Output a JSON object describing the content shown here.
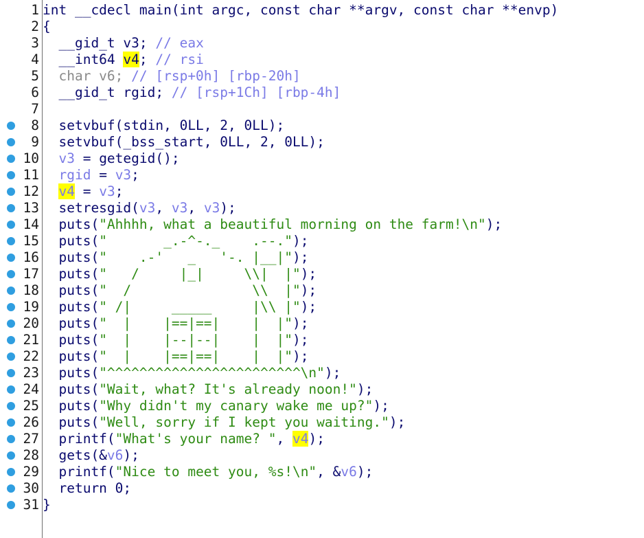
{
  "editor": {
    "lines": [
      {
        "no": "1",
        "bp": false,
        "parts": [
          {
            "c": "kw",
            "t": "int __cdecl main(int argc, const char **argv, const char **envp)"
          }
        ]
      },
      {
        "no": "2",
        "bp": false,
        "parts": [
          {
            "c": "kw",
            "t": "{"
          }
        ]
      },
      {
        "no": "3",
        "bp": false,
        "parts": [
          {
            "c": "kw",
            "t": "  __gid_t v3; "
          },
          {
            "c": "cm",
            "t": "// eax"
          }
        ]
      },
      {
        "no": "4",
        "bp": false,
        "parts": [
          {
            "c": "kw",
            "t": "  __int64 "
          },
          {
            "c": "kw hl",
            "t": "v4"
          },
          {
            "c": "kw",
            "t": "; "
          },
          {
            "c": "cm",
            "t": "// rsi"
          }
        ]
      },
      {
        "no": "5",
        "bp": false,
        "parts": [
          {
            "c": "gr",
            "t": "  char v6; "
          },
          {
            "c": "cm",
            "t": "// [rsp+0h] [rbp-20h]"
          }
        ]
      },
      {
        "no": "6",
        "bp": false,
        "parts": [
          {
            "c": "kw",
            "t": "  __gid_t rgid; "
          },
          {
            "c": "cm",
            "t": "// [rsp+1Ch] [rbp-4h]"
          }
        ]
      },
      {
        "no": "7",
        "bp": false,
        "parts": [
          {
            "c": "kw",
            "t": ""
          }
        ]
      },
      {
        "no": "8",
        "bp": true,
        "parts": [
          {
            "c": "kw",
            "t": "  setvbuf(stdin, 0LL, 2, 0LL);"
          }
        ]
      },
      {
        "no": "9",
        "bp": true,
        "parts": [
          {
            "c": "kw",
            "t": "  setvbuf(_bss_start, 0LL, 2, 0LL);"
          }
        ]
      },
      {
        "no": "10",
        "bp": true,
        "parts": [
          {
            "c": "kw",
            "t": "  "
          },
          {
            "c": "v",
            "t": "v3"
          },
          {
            "c": "kw",
            "t": " = getegid();"
          }
        ]
      },
      {
        "no": "11",
        "bp": true,
        "parts": [
          {
            "c": "kw",
            "t": "  "
          },
          {
            "c": "v",
            "t": "rgid"
          },
          {
            "c": "kw",
            "t": " = "
          },
          {
            "c": "v",
            "t": "v3"
          },
          {
            "c": "kw",
            "t": ";"
          }
        ]
      },
      {
        "no": "12",
        "bp": true,
        "parts": [
          {
            "c": "kw",
            "t": "  "
          },
          {
            "c": "v hl",
            "t": "v4"
          },
          {
            "c": "kw",
            "t": " = "
          },
          {
            "c": "v",
            "t": "v3"
          },
          {
            "c": "kw",
            "t": ";"
          }
        ]
      },
      {
        "no": "13",
        "bp": true,
        "parts": [
          {
            "c": "kw",
            "t": "  setresgid("
          },
          {
            "c": "v",
            "t": "v3"
          },
          {
            "c": "kw",
            "t": ", "
          },
          {
            "c": "v",
            "t": "v3"
          },
          {
            "c": "kw",
            "t": ", "
          },
          {
            "c": "v",
            "t": "v3"
          },
          {
            "c": "kw",
            "t": ");"
          }
        ]
      },
      {
        "no": "14",
        "bp": true,
        "parts": [
          {
            "c": "kw",
            "t": "  puts("
          },
          {
            "c": "st",
            "t": "\"Ahhhh, what a beautiful morning on the farm!\\n\""
          },
          {
            "c": "kw",
            "t": ");"
          }
        ]
      },
      {
        "no": "15",
        "bp": true,
        "parts": [
          {
            "c": "kw",
            "t": "  puts("
          },
          {
            "c": "st",
            "t": "\"       _.-^-._    .--.\""
          },
          {
            "c": "kw",
            "t": ");"
          }
        ]
      },
      {
        "no": "16",
        "bp": true,
        "parts": [
          {
            "c": "kw",
            "t": "  puts("
          },
          {
            "c": "st",
            "t": "\"    .-'   _   '-. |__|\""
          },
          {
            "c": "kw",
            "t": ");"
          }
        ]
      },
      {
        "no": "17",
        "bp": true,
        "parts": [
          {
            "c": "kw",
            "t": "  puts("
          },
          {
            "c": "st",
            "t": "\"   /     |_|     \\\\|  |\""
          },
          {
            "c": "kw",
            "t": ");"
          }
        ]
      },
      {
        "no": "18",
        "bp": true,
        "parts": [
          {
            "c": "kw",
            "t": "  puts("
          },
          {
            "c": "st",
            "t": "\"  /               \\\\  |\""
          },
          {
            "c": "kw",
            "t": ");"
          }
        ]
      },
      {
        "no": "19",
        "bp": true,
        "parts": [
          {
            "c": "kw",
            "t": "  puts("
          },
          {
            "c": "st",
            "t": "\" /|     _____     |\\\\ |\""
          },
          {
            "c": "kw",
            "t": ");"
          }
        ]
      },
      {
        "no": "20",
        "bp": true,
        "parts": [
          {
            "c": "kw",
            "t": "  puts("
          },
          {
            "c": "st",
            "t": "\"  |    |==|==|    |  |\""
          },
          {
            "c": "kw",
            "t": ");"
          }
        ]
      },
      {
        "no": "21",
        "bp": true,
        "parts": [
          {
            "c": "kw",
            "t": "  puts("
          },
          {
            "c": "st",
            "t": "\"  |    |--|--|    |  |\""
          },
          {
            "c": "kw",
            "t": ");"
          }
        ]
      },
      {
        "no": "22",
        "bp": true,
        "parts": [
          {
            "c": "kw",
            "t": "  puts("
          },
          {
            "c": "st",
            "t": "\"  |    |==|==|    |  |\""
          },
          {
            "c": "kw",
            "t": ");"
          }
        ]
      },
      {
        "no": "23",
        "bp": true,
        "parts": [
          {
            "c": "kw",
            "t": "  puts("
          },
          {
            "c": "st",
            "t": "\"^^^^^^^^^^^^^^^^^^^^^^^^\\n\""
          },
          {
            "c": "kw",
            "t": ");"
          }
        ]
      },
      {
        "no": "24",
        "bp": true,
        "parts": [
          {
            "c": "kw",
            "t": "  puts("
          },
          {
            "c": "st",
            "t": "\"Wait, what? It's already noon!\""
          },
          {
            "c": "kw",
            "t": ");"
          }
        ]
      },
      {
        "no": "25",
        "bp": true,
        "parts": [
          {
            "c": "kw",
            "t": "  puts("
          },
          {
            "c": "st",
            "t": "\"Why didn't my canary wake me up?\""
          },
          {
            "c": "kw",
            "t": ");"
          }
        ]
      },
      {
        "no": "26",
        "bp": true,
        "parts": [
          {
            "c": "kw",
            "t": "  puts("
          },
          {
            "c": "st",
            "t": "\"Well, sorry if I kept you waiting.\""
          },
          {
            "c": "kw",
            "t": ");"
          }
        ]
      },
      {
        "no": "27",
        "bp": true,
        "parts": [
          {
            "c": "kw",
            "t": "  printf("
          },
          {
            "c": "st",
            "t": "\"What's your name? \""
          },
          {
            "c": "kw",
            "t": ", "
          },
          {
            "c": "v hl",
            "t": "v",
            "caret": true
          },
          {
            "c": "v hl",
            "t": "4"
          },
          {
            "c": "kw",
            "t": ");"
          }
        ]
      },
      {
        "no": "28",
        "bp": true,
        "parts": [
          {
            "c": "kw",
            "t": "  gets(&"
          },
          {
            "c": "v",
            "t": "v6"
          },
          {
            "c": "kw",
            "t": ");"
          }
        ]
      },
      {
        "no": "29",
        "bp": true,
        "parts": [
          {
            "c": "kw",
            "t": "  printf("
          },
          {
            "c": "st",
            "t": "\"Nice to meet you, %s!\\n\""
          },
          {
            "c": "kw",
            "t": ", &"
          },
          {
            "c": "v",
            "t": "v6"
          },
          {
            "c": "kw",
            "t": ");"
          }
        ]
      },
      {
        "no": "30",
        "bp": true,
        "parts": [
          {
            "c": "kw",
            "t": "  return 0;"
          }
        ]
      },
      {
        "no": "31",
        "bp": true,
        "parts": [
          {
            "c": "kw",
            "t": "}"
          }
        ]
      }
    ],
    "colors": {
      "keyword": "#0a0a6e",
      "variable": "#7a7ae6",
      "string": "#2e8b13",
      "highlight": "#ffff00",
      "breakpoint": "#2f9ee0"
    },
    "icons": {
      "breakpoint": "breakpoint-dot-icon"
    }
  }
}
